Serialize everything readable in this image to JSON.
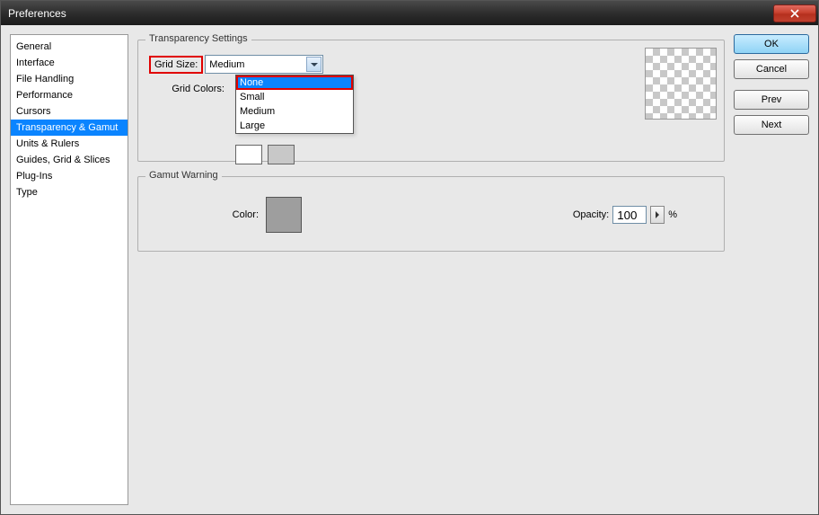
{
  "window": {
    "title": "Preferences"
  },
  "sidebar": {
    "items": [
      {
        "label": "General"
      },
      {
        "label": "Interface"
      },
      {
        "label": "File Handling"
      },
      {
        "label": "Performance"
      },
      {
        "label": "Cursors"
      },
      {
        "label": "Transparency & Gamut",
        "selected": true
      },
      {
        "label": "Units & Rulers"
      },
      {
        "label": "Guides, Grid & Slices"
      },
      {
        "label": "Plug-Ins"
      },
      {
        "label": "Type"
      }
    ]
  },
  "transparency": {
    "legend": "Transparency Settings",
    "grid_size_label": "Grid Size:",
    "grid_size_value": "Medium",
    "grid_size_options": [
      "None",
      "Small",
      "Medium",
      "Large"
    ],
    "grid_colors_label": "Grid Colors:"
  },
  "gamut": {
    "legend": "Gamut Warning",
    "color_label": "Color:",
    "opacity_label": "Opacity:",
    "opacity_value": "100",
    "opacity_suffix": "%"
  },
  "buttons": {
    "ok": "OK",
    "cancel": "Cancel",
    "prev": "Prev",
    "next": "Next"
  }
}
